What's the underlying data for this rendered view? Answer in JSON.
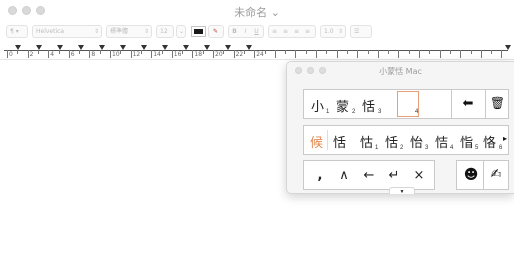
{
  "document": {
    "title": "未命名 ⌄"
  },
  "toolbar": {
    "paragraph_style": "¶ ▾",
    "font_family": "Helvetica",
    "font_style": "標準體",
    "font_size": "12",
    "text_color": "#1a1a1a",
    "bold": "B",
    "italic": "I",
    "underline": "U",
    "line_spacing": "1.0",
    "list": "☰"
  },
  "ruler": {
    "labels": [
      "0",
      "2",
      "4",
      "6",
      "8",
      "10",
      "12",
      "14",
      "16",
      "18",
      "20",
      "22",
      "24"
    ]
  },
  "ime": {
    "title": "小蒙恬 Mac",
    "composition": [
      {
        "char": "小",
        "index": "1"
      },
      {
        "char": "蒙",
        "index": "2"
      },
      {
        "char": "恬",
        "index": "3"
      },
      {
        "char": "",
        "index": "4"
      }
    ],
    "backspace_icon": "⬅",
    "trash_icon": "🗑",
    "candidate_label": "候",
    "candidates": [
      {
        "char": "恬",
        "index": ""
      },
      {
        "char": "怙",
        "index": "1"
      },
      {
        "char": "恬",
        "index": "2"
      },
      {
        "char": "怡",
        "index": "3"
      },
      {
        "char": "恄",
        "index": "4"
      },
      {
        "char": "恉",
        "index": "5"
      },
      {
        "char": "恪",
        "index": "6"
      }
    ],
    "more_arrow": "▸",
    "keys": [
      ",",
      "∧",
      "←",
      "↵",
      "×"
    ],
    "accent_color": "#e6a07b",
    "candidate_label_color": "#e08a50"
  }
}
